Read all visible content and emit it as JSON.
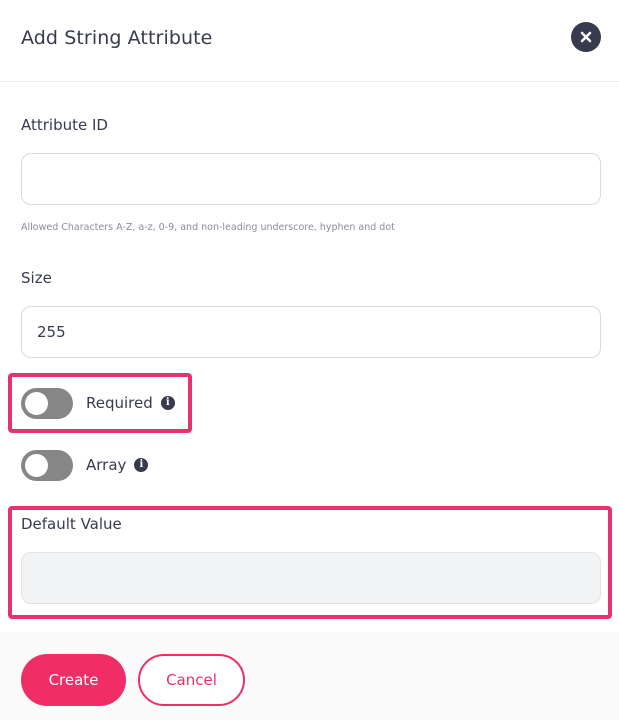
{
  "dialog": {
    "title": "Add String Attribute",
    "close_icon": "close-icon"
  },
  "fields": {
    "attribute_id": {
      "label": "Attribute ID",
      "value": "",
      "placeholder": "",
      "hint": "Allowed Characters A-Z, a-z, 0-9, and non-leading underscore, hyphen and dot"
    },
    "size": {
      "label": "Size",
      "value": "255"
    },
    "required": {
      "label": "Required",
      "checked": false,
      "icon": "info-icon"
    },
    "array": {
      "label": "Array",
      "checked": false,
      "icon": "info-icon"
    },
    "default_value": {
      "label": "Default Value",
      "value": "",
      "disabled": true
    }
  },
  "footer": {
    "create_label": "Create",
    "cancel_label": "Cancel"
  },
  "colors": {
    "accent": "#f02e65",
    "highlight": "#e8326b",
    "text": "#373b4d",
    "toggle_off": "#868686"
  }
}
